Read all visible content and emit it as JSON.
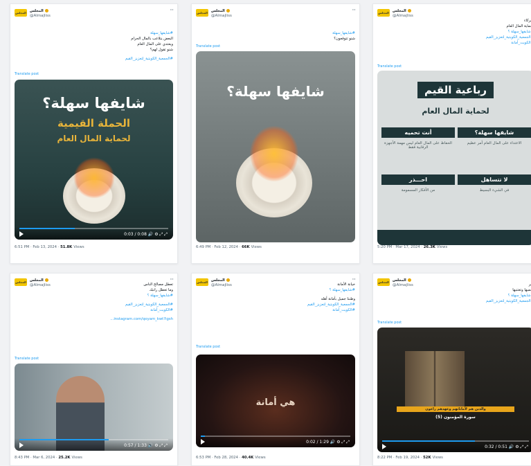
{
  "colors": {
    "accent": "#1d9bf0",
    "avatar": "#f2c500"
  },
  "account": {
    "name": "المجلس",
    "handle": "@Almajliss",
    "avatar_text": "المجلس"
  },
  "translate": "Translate post",
  "views_label": "Views",
  "posts": [
    {
      "lines": [
        "#شايفها_سهلة",
        "البعض يتلاعب بالمال الحرام",
        "ويعتدي على المال العام",
        "شنو تقول لهم؟"
      ],
      "tag_line": "#الجمعية_الكويتية_لتعزيز_القيم",
      "media_type": "video",
      "media_title": "شايفها سهلة؟",
      "media_sub1": "الحملة القيمية",
      "media_sub2": "لحماية المال العام",
      "time": "0:03 / 0:08",
      "progress": 0.37,
      "date": "6:51 PM · Feb 13, 2024 · ",
      "views": "51.8K"
    },
    {
      "lines": [
        "#شايفها_سهلة",
        "شنو تتوقعون؟"
      ],
      "media_type": "image",
      "media_title": "شايفها سهلة؟",
      "date": "6:49 PM · Feb 12, 2024 · ",
      "views": "66K"
    },
    {
      "lines": [
        "شركاء",
        "لحماية المال العام",
        "#شايفها_سهلة ؟",
        "#الجمعية_الكويتية_لتعزيز_القيم",
        "#الكويت_أمانة"
      ],
      "media_type": "infographic",
      "media_title": "رباعية القيم",
      "media_sub": "لحماية المال العام",
      "boxes": [
        "أنت تحميه",
        "شايفها سهلة؟",
        "احـــذر",
        "لا تتساهل"
      ],
      "box_text": [
        "الحفاظ على المال العام ليس مهمة الأجهزة الرقابية فقط",
        "الاعتداء على المال العام أمر عظيم",
        "من الأفكار المسمومة",
        "في الشيء البسيط"
      ],
      "date": "5:20 PM · Mar 17, 2024 · ",
      "views": "26.3K"
    },
    {
      "lines": [
        "تعطل مصالح الناس",
        "وما تعطل راتبك",
        "#شايفها_سهلة ؟",
        "",
        "#الجمعية_الكويتية_لتعزيز_القيم",
        "#الكويت_أمانة",
        "",
        "instagram.com/qeyam_kwt?igsh..."
      ],
      "media_type": "video",
      "time": "0:57 / 1:33",
      "progress": 0.6,
      "date": "8:43 PM · Mar 6, 2024 · ",
      "views": "25.2K"
    },
    {
      "lines": [
        "خيانة الأمانة",
        "#شايفها_سهلة ؟",
        "",
        "وطننا جميل بأمانة أهله",
        "#الجمعية_الكويتية_لتعزيز_القيم",
        "#الكويت_أمانة"
      ],
      "media_type": "video",
      "media_title": "هي أمانة",
      "time": "0:02 / 1:29",
      "progress": 0.03,
      "date": "6:53 PM · Feb 28, 2024 · ",
      "views": "40.4K"
    },
    {
      "lines": [
        "غير",
        "تحميها وتعتنيها",
        "#شايفها_سهلة ؟",
        "#الجمعية_الكويتية_لتعزيز_القيم"
      ],
      "media_type": "video",
      "media_sub1": "والذين هم لأماناتهم وعهدهم راعون",
      "media_sub2": "سورة المؤمنون (5)",
      "time": "0:32 / 0:51",
      "progress": 0.63,
      "date": "8:22 PM · Feb 19, 2024 · ",
      "views": "52K"
    }
  ]
}
